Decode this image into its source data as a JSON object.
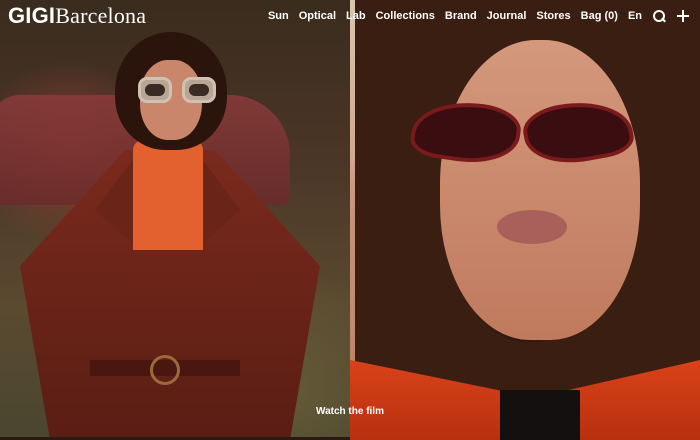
{
  "brand": {
    "logo_bold": "GIGI",
    "logo_light": "Barcelona"
  },
  "nav": {
    "items": [
      {
        "label": "Sun"
      },
      {
        "label": "Optical"
      },
      {
        "label": "Lab"
      },
      {
        "label": "Collections"
      },
      {
        "label": "Brand"
      },
      {
        "label": "Journal"
      },
      {
        "label": "Stores"
      },
      {
        "label": "Bag (0)"
      },
      {
        "label": "En"
      }
    ],
    "icons": [
      "search-icon",
      "plus-icon"
    ]
  },
  "hero": {
    "cta_label": "Watch the film"
  },
  "colors": {
    "text": "#ffffff",
    "jacket": "#7a2a1c",
    "coat": "#d9421a"
  }
}
